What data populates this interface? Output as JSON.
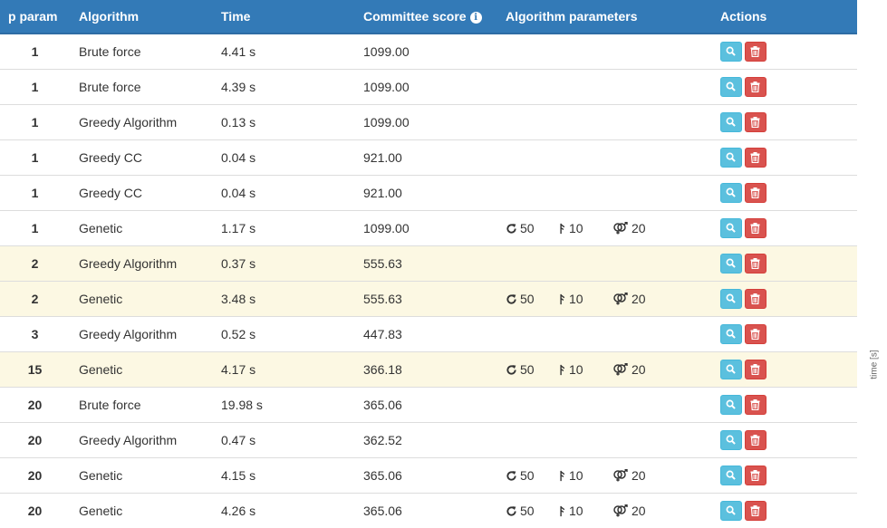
{
  "table": {
    "headers": {
      "p_param": "p param",
      "algorithm": "Algorithm",
      "time": "Time",
      "committee_score": "Committee score",
      "algorithm_parameters": "Algorithm parameters",
      "actions": "Actions"
    },
    "rows": [
      {
        "p": "1",
        "algorithm": "Brute force",
        "time": "4.41 s",
        "score": "1099.00",
        "highlight": false,
        "params": null
      },
      {
        "p": "1",
        "algorithm": "Brute force",
        "time": "4.39 s",
        "score": "1099.00",
        "highlight": false,
        "params": null
      },
      {
        "p": "1",
        "algorithm": "Greedy Algorithm",
        "time": "0.13 s",
        "score": "1099.00",
        "highlight": false,
        "params": null
      },
      {
        "p": "1",
        "algorithm": "Greedy CC",
        "time": "0.04 s",
        "score": "921.00",
        "highlight": false,
        "params": null
      },
      {
        "p": "1",
        "algorithm": "Greedy CC",
        "time": "0.04 s",
        "score": "921.00",
        "highlight": false,
        "params": null
      },
      {
        "p": "1",
        "algorithm": "Genetic",
        "time": "1.17 s",
        "score": "1099.00",
        "highlight": false,
        "params": {
          "generations": "50",
          "mutation": "10",
          "population": "20"
        }
      },
      {
        "p": "2",
        "algorithm": "Greedy Algorithm",
        "time": "0.37 s",
        "score": "555.63",
        "highlight": true,
        "params": null
      },
      {
        "p": "2",
        "algorithm": "Genetic",
        "time": "3.48 s",
        "score": "555.63",
        "highlight": true,
        "params": {
          "generations": "50",
          "mutation": "10",
          "population": "20"
        }
      },
      {
        "p": "3",
        "algorithm": "Greedy Algorithm",
        "time": "0.52 s",
        "score": "447.83",
        "highlight": false,
        "params": null
      },
      {
        "p": "15",
        "algorithm": "Genetic",
        "time": "4.17 s",
        "score": "366.18",
        "highlight": true,
        "params": {
          "generations": "50",
          "mutation": "10",
          "population": "20"
        }
      },
      {
        "p": "20",
        "algorithm": "Brute force",
        "time": "19.98 s",
        "score": "365.06",
        "highlight": false,
        "params": null
      },
      {
        "p": "20",
        "algorithm": "Greedy Algorithm",
        "time": "0.47 s",
        "score": "362.52",
        "highlight": false,
        "params": null
      },
      {
        "p": "20",
        "algorithm": "Genetic",
        "time": "4.15 s",
        "score": "365.06",
        "highlight": false,
        "params": {
          "generations": "50",
          "mutation": "10",
          "population": "20"
        }
      },
      {
        "p": "20",
        "algorithm": "Genetic",
        "time": "4.26 s",
        "score": "365.06",
        "highlight": false,
        "params": {
          "generations": "50",
          "mutation": "10",
          "population": "20"
        }
      }
    ]
  },
  "icons": {
    "info": "info-icon",
    "generations": "refresh-icon",
    "mutation": "mutation-icon",
    "population": "genders-icon",
    "view": "search-icon",
    "delete": "trash-icon"
  },
  "colors": {
    "header_bg": "#337ab7",
    "highlight_row": "#fcf8e3",
    "view_button": "#5bc0de",
    "delete_button": "#d9534f"
  },
  "side_axis": {
    "label": "time [s]"
  }
}
